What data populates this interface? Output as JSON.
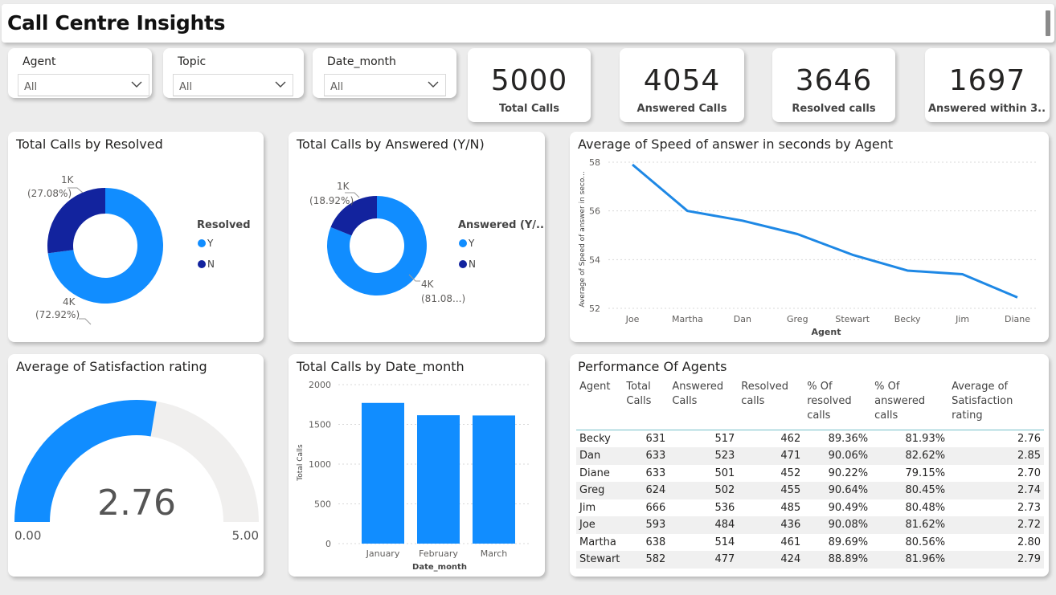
{
  "app": {
    "title": "Call Centre Insights"
  },
  "slicers": [
    {
      "label": "Agent",
      "value": "All"
    },
    {
      "label": "Topic",
      "value": "All"
    },
    {
      "label": "Date_month",
      "value": "All"
    }
  ],
  "kpis": [
    {
      "value": "5000",
      "caption": "Total Calls"
    },
    {
      "value": "4054",
      "caption": "Answered Calls"
    },
    {
      "value": "3646",
      "caption": "Resolved calls"
    },
    {
      "value": "1697",
      "caption": "Answered within 3..."
    }
  ],
  "colors": {
    "primary": "#118DFF",
    "dark": "#12239E",
    "gauge_bg": "#F0EFEE",
    "line": "#1E88E5"
  },
  "chart_data": [
    {
      "type": "pie",
      "title": "Total Calls by Resolved",
      "legend_title": "Resolved",
      "legend_position": "right",
      "slices": [
        {
          "name": "Y",
          "value": 4000,
          "label": "4K",
          "pct_label": "(72.92%)",
          "color": "#118DFF"
        },
        {
          "name": "N",
          "value": 1000,
          "label": "1K",
          "pct_label": "(27.08%)",
          "color": "#12239E"
        }
      ],
      "fractions": [
        0.7292,
        0.2708
      ]
    },
    {
      "type": "pie",
      "title": "Total Calls by Answered (Y/N)",
      "legend_title": "Answered (Y/...",
      "legend_position": "right",
      "slices": [
        {
          "name": "Y",
          "value": 4000,
          "label": "4K",
          "pct_label": "(81.08...)",
          "color": "#118DFF"
        },
        {
          "name": "N",
          "value": 1000,
          "label": "1K",
          "pct_label": "(18.92%)",
          "color": "#12239E"
        }
      ],
      "fractions": [
        0.8108,
        0.1892
      ]
    },
    {
      "type": "line",
      "title": "Average of Speed of answer in seconds by Agent",
      "xlabel": "Agent",
      "ylabel": "Average of Speed of answer in seco...",
      "categories": [
        "Joe",
        "Martha",
        "Dan",
        "Greg",
        "Stewart",
        "Becky",
        "Jim",
        "Diane"
      ],
      "values": [
        57.9,
        56.0,
        55.6,
        55.05,
        54.2,
        53.55,
        53.4,
        52.45
      ],
      "ylim": [
        52,
        58
      ],
      "yticks": [
        52,
        54,
        56,
        58
      ],
      "grid": true
    },
    {
      "type": "gauge",
      "title": "Average of Satisfaction rating",
      "value": 2.76,
      "value_label": "2.76",
      "min": 0,
      "max": 5,
      "min_label": "0.00",
      "max_label": "5.00"
    },
    {
      "type": "bar",
      "title": "Total Calls by Date_month",
      "xlabel": "Date_month",
      "ylabel": "Total Calls",
      "categories": [
        "January",
        "February",
        "March"
      ],
      "values": [
        1770,
        1615,
        1612
      ],
      "ylim": [
        0,
        2000
      ],
      "yticks": [
        0,
        500,
        1000,
        1500,
        2000
      ],
      "grid": true
    }
  ],
  "table": {
    "title": "Performance Of Agents",
    "columns": [
      "Agent",
      "Total Calls",
      "Answered Calls",
      "Resolved calls",
      "% Of resolved calls",
      "% Of answered calls",
      "Average of Satisfaction rating"
    ],
    "rows": [
      [
        "Becky",
        "631",
        "517",
        "462",
        "89.36%",
        "81.93%",
        "2.76"
      ],
      [
        "Dan",
        "633",
        "523",
        "471",
        "90.06%",
        "82.62%",
        "2.85"
      ],
      [
        "Diane",
        "633",
        "501",
        "452",
        "90.22%",
        "79.15%",
        "2.70"
      ],
      [
        "Greg",
        "624",
        "502",
        "455",
        "90.64%",
        "80.45%",
        "2.74"
      ],
      [
        "Jim",
        "666",
        "536",
        "485",
        "90.49%",
        "80.48%",
        "2.73"
      ],
      [
        "Joe",
        "593",
        "484",
        "436",
        "90.08%",
        "81.62%",
        "2.72"
      ],
      [
        "Martha",
        "638",
        "514",
        "461",
        "89.69%",
        "80.56%",
        "2.80"
      ],
      [
        "Stewart",
        "582",
        "477",
        "424",
        "88.89%",
        "81.96%",
        "2.79"
      ]
    ]
  }
}
